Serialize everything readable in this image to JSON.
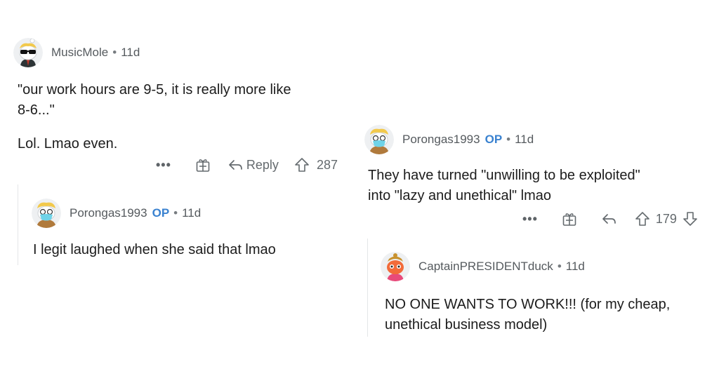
{
  "comments": [
    {
      "username": "MusicMole",
      "age": "11d",
      "lines": [
        "\"our work hours are 9-5, it is really more like",
        "8-6...\""
      ],
      "extra": "Lol. Lmao even.",
      "actions": {
        "reply_label": "Reply",
        "votes": "287"
      }
    },
    {
      "username": "Porongas1993",
      "op_badge": "OP",
      "age": "11d",
      "text": "I legit laughed when she said that lmao"
    },
    {
      "username": "Porongas1993",
      "op_badge": "OP",
      "age": "11d",
      "lines": [
        "They have turned \"unwilling to be exploited\"",
        "into \"lazy and unethical\" lmao"
      ],
      "actions": {
        "votes": "179"
      }
    },
    {
      "username": "CaptainPRESIDENTduck",
      "age": "11d",
      "lines": [
        "NO ONE WANTS TO WORK!!! (for my cheap,",
        "unethical business model)"
      ]
    }
  ],
  "separator": "•",
  "more_label": "•••",
  "icons": {
    "more": "more-options-icon",
    "award": "award-gift-icon",
    "reply": "reply-arrow-icon",
    "upvote": "upvote-arrow-icon",
    "downvote": "downvote-arrow-icon"
  },
  "colors": {
    "op": "#3a82d0",
    "meta": "#555a5e",
    "text": "#1c1c1c",
    "thread": "#e4e6e8"
  }
}
